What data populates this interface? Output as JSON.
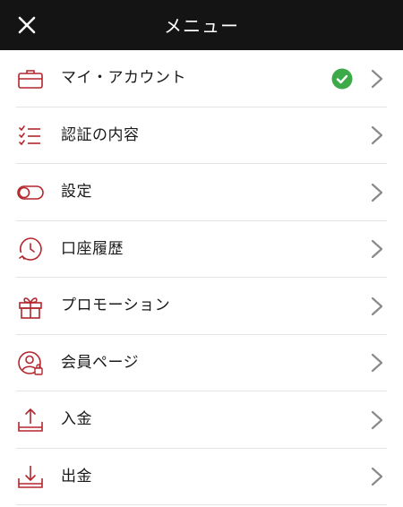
{
  "header": {
    "title": "メニュー",
    "close_icon": "close-icon"
  },
  "colors": {
    "header_bg": "#141414",
    "icon_accent": "#b3262d",
    "verified": "#3daa4a",
    "chevron": "#8a8a8a"
  },
  "menu": {
    "items": [
      {
        "label": "マイ・アカウント",
        "icon": "briefcase-icon",
        "verified": true
      },
      {
        "label": "認証の内容",
        "icon": "checklist-icon"
      },
      {
        "label": "設定",
        "icon": "toggle-icon"
      },
      {
        "label": "口座履歴",
        "icon": "history-clock-icon"
      },
      {
        "label": "プロモーション",
        "icon": "gift-icon"
      },
      {
        "label": "会員ページ",
        "icon": "member-lock-icon"
      },
      {
        "label": "入金",
        "icon": "deposit-upload-icon"
      },
      {
        "label": "出金",
        "icon": "withdraw-download-icon"
      }
    ]
  }
}
